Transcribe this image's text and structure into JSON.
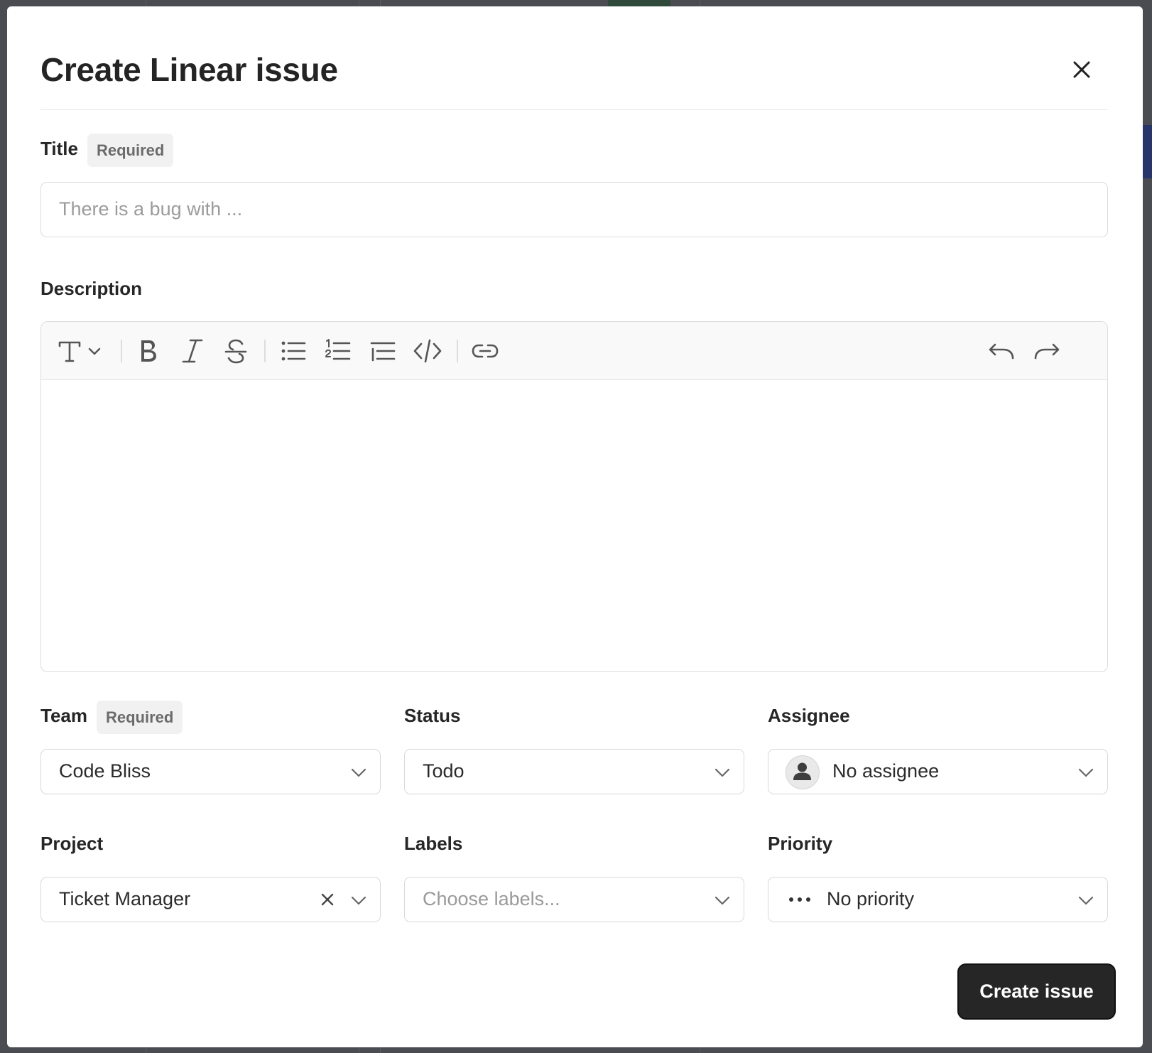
{
  "dialog": {
    "title": "Create Linear issue",
    "close_icon": "close-icon"
  },
  "form": {
    "title_field": {
      "label": "Title",
      "required_badge": "Required",
      "placeholder": "There is a bug with ..."
    },
    "description": {
      "label": "Description",
      "toolbar": {
        "icons": [
          "text-style-icon",
          "chevron-down-icon",
          "bold-icon",
          "italic-icon",
          "strikethrough-icon",
          "bullet-list-icon",
          "numbered-list-icon",
          "indent-list-icon",
          "code-icon",
          "link-icon",
          "undo-icon",
          "redo-icon"
        ]
      }
    },
    "team": {
      "label": "Team",
      "required_badge": "Required",
      "value": "Code Bliss"
    },
    "status": {
      "label": "Status",
      "value": "Todo"
    },
    "assignee": {
      "label": "Assignee",
      "value": "No assignee",
      "icon": "person-icon"
    },
    "project": {
      "label": "Project",
      "value": "Ticket Manager"
    },
    "labels": {
      "label": "Labels",
      "placeholder": "Choose labels..."
    },
    "priority": {
      "label": "Priority",
      "value": "No priority",
      "icon": "dots-icon"
    }
  },
  "actions": {
    "create_label": "Create issue"
  }
}
